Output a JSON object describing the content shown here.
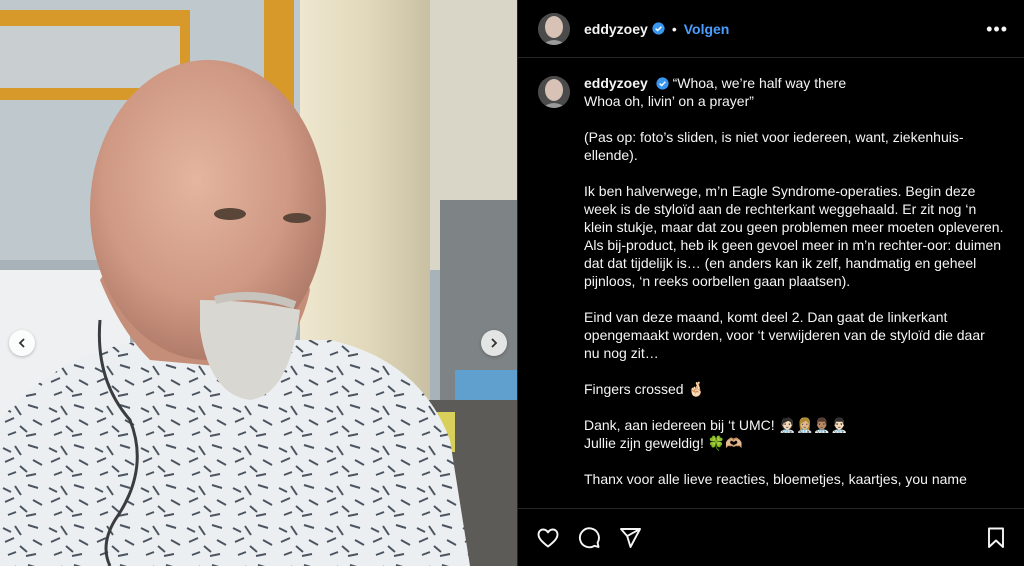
{
  "post": {
    "username": "eddyzoey",
    "follow_label": "Volgen",
    "separator": "•",
    "more_label": "•••",
    "icons": {
      "verified": "verified-badge-icon",
      "prev": "chevron-left-icon",
      "next": "chevron-right-icon",
      "like": "heart-icon",
      "comment": "comment-icon",
      "share": "paper-plane-icon",
      "save": "bookmark-icon"
    },
    "colors": {
      "background": "#000000",
      "link": "#4a9eff",
      "verified": "#3897f0"
    }
  },
  "caption": {
    "username": "eddyzoey",
    "line1": "“Whoa, we’re half way there",
    "line2": "Whoa oh, livin’ on a prayer”",
    "p2": "(Pas op: foto’s sliden, is niet voor iedereen, want, ziekenhuis-ellende).",
    "p3": "Ik ben halverwege, m’n Eagle Syndrome-operaties. Begin deze week is de styloïd aan de rechterkant weggehaald. Er zit nog ‘n klein stukje, maar dat zou geen problemen meer moeten opleveren. Als bij-product, heb ik geen gevoel meer in m’n rechter-oor: duimen dat dat tijdelijk is… (en anders kan ik zelf, handmatig en geheel pijnloos, ‘n reeks oorbellen gaan plaatsen).",
    "p4": "Eind van deze maand, komt deel 2. Dan gaat de linkerkant opengemaakt worden, voor ‘t verwijderen van de styloïd die daar nu nog zit…",
    "p5": "Fingers crossed 🤞🏻",
    "p6a": "Dank, aan iedereen bij ‘t UMC! 🧑🏻‍⚕️👩🏼‍⚕️👨🏽‍⚕️👨🏻‍⚕️",
    "p6b": "Jullie zijn geweldig! 🍀🫶🏼",
    "p7": "Thanx voor alle lieve reacties, bloemetjes, kaartjes, you name"
  }
}
